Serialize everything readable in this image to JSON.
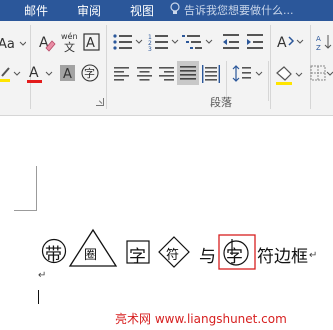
{
  "ribbon_tabs": [
    "邮件",
    "审阅",
    "视图"
  ],
  "tell_me": "告诉我您想要做什么...",
  "paragraph_group_label": "段落",
  "phonetic_top": "wén",
  "phonetic_bottom": "文",
  "font_color_letter": "A",
  "clear_format_letter": "A",
  "char_shading_letter": "A",
  "enclose_char": "字",
  "document": {
    "c1": "带",
    "c2": "圈",
    "c3": "字",
    "c4": "符",
    "c5": "与",
    "c6": "字",
    "rest": "符边框",
    "return_mark": "↵",
    "empty_return": "↵"
  },
  "watermark": "亮术网 www.liangshunet.com",
  "colors": {
    "tab_bar": "#2b579a",
    "font_red": "#e31b1b",
    "highlight_yellow": "#ffe500",
    "selection_box": "#d71f1f"
  }
}
